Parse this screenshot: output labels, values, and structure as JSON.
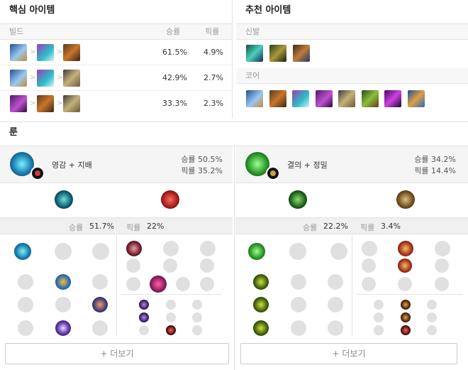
{
  "core_items": {
    "title": "핵심 아이템",
    "col_build": "빌드",
    "col_winrate": "승률",
    "col_pickrate": "픽률",
    "rows": [
      {
        "win": "61.5%",
        "pick": "4.9%"
      },
      {
        "win": "42.9%",
        "pick": "2.7%"
      },
      {
        "win": "33.3%",
        "pick": "2.3%"
      }
    ]
  },
  "recommended": {
    "title": "추천 아이템",
    "boots_label": "신발",
    "core_label": "코어"
  },
  "runes": {
    "title": "룬",
    "left": {
      "name": "영감 + 지배",
      "win": "승률 50.5%",
      "pick": "픽률 35.2%",
      "stat_win_label": "승률",
      "stat_win": "51.7%",
      "stat_pick_label": "픽률",
      "stat_pick": "22%"
    },
    "right": {
      "name": "결의 + 정밀",
      "win": "승률 34.2%",
      "pick": "픽률 14.4%",
      "stat_win_label": "승률",
      "stat_win": "22.2%",
      "stat_pick_label": "픽률",
      "stat_pick": "3.4%"
    },
    "more_label": "+ 더보기"
  },
  "colors": {
    "blue_item": "#3a6fb5",
    "purple_item": "#7b2ea8",
    "brown_item": "#6b4a2a",
    "teal": "#0fa3a3",
    "red": "#c8313a",
    "green": "#3fae3a",
    "gold": "#a8873a"
  }
}
